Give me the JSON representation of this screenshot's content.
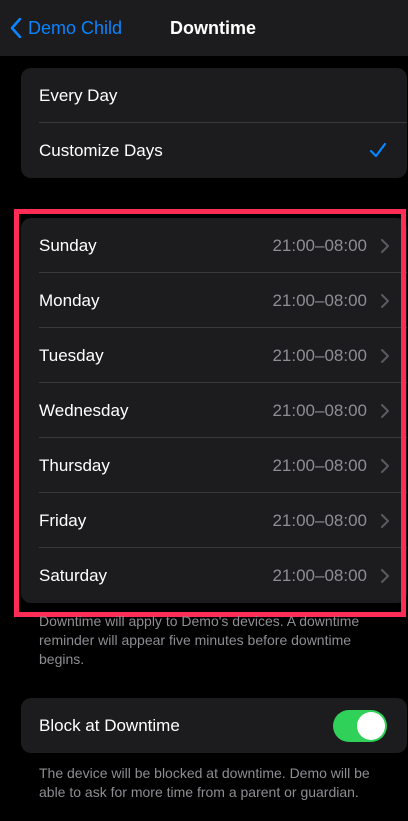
{
  "nav": {
    "back_label": "Demo Child",
    "title": "Downtime"
  },
  "mode": {
    "every_day": "Every Day",
    "customize_days": "Customize Days"
  },
  "days": [
    {
      "name": "Sunday",
      "time": "21:00–08:00"
    },
    {
      "name": "Monday",
      "time": "21:00–08:00"
    },
    {
      "name": "Tuesday",
      "time": "21:00–08:00"
    },
    {
      "name": "Wednesday",
      "time": "21:00–08:00"
    },
    {
      "name": "Thursday",
      "time": "21:00–08:00"
    },
    {
      "name": "Friday",
      "time": "21:00–08:00"
    },
    {
      "name": "Saturday",
      "time": "21:00–08:00"
    }
  ],
  "days_footer": "Downtime will apply to Demo's devices. A downtime reminder will appear five minutes before downtime begins.",
  "block": {
    "label": "Block at Downtime",
    "enabled": true
  },
  "block_footer": "The device will be blocked at downtime. Demo will be able to ask for more time from a parent or guardian.",
  "colors": {
    "accent": "#0a84ff",
    "toggle_on": "#30d158",
    "highlight": "#ff2d55"
  }
}
